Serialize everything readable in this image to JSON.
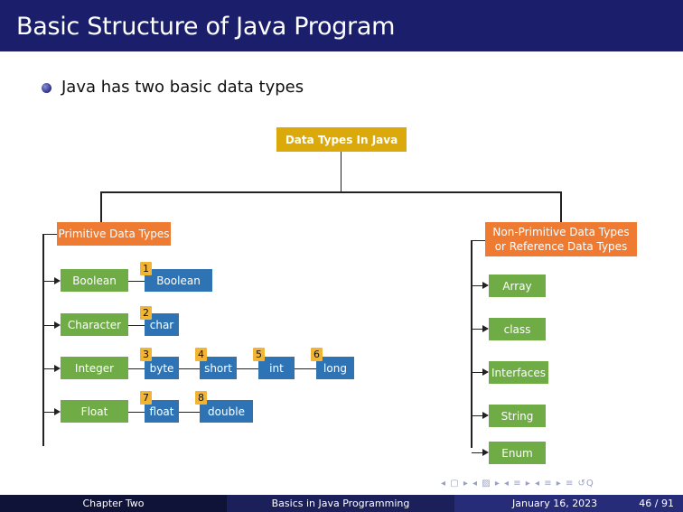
{
  "slide": {
    "title": "Basic Structure of Java Program",
    "bullet": "Java has two basic data types"
  },
  "diagram": {
    "root": "Data Types In Java",
    "primitive": {
      "header": "Primitive Data Types",
      "categories": [
        "Boolean",
        "Character",
        "Integer",
        "Float"
      ],
      "types": [
        "Boolean",
        "char",
        "byte",
        "short",
        "int",
        "long",
        "float",
        "double"
      ],
      "numbers": [
        "1",
        "2",
        "3",
        "4",
        "5",
        "6",
        "7",
        "8"
      ]
    },
    "non_primitive": {
      "header_line1": "Non-Primitive Data Types",
      "header_line2": "or Reference Data Types",
      "items": [
        "Array",
        "class",
        "Interfaces",
        "String",
        "Enum"
      ]
    },
    "colors": {
      "root": "#dca90a",
      "header": "#ef7b32",
      "category": "#6fac46",
      "type": "#2e74b5",
      "number": "#f2b435"
    }
  },
  "footer": {
    "section": "Chapter Two",
    "course": "Basics in Java Programming",
    "date": "January 16, 2023",
    "page": "46 / 91"
  },
  "navigation": {
    "controls": "◂ ▢ ▸ ◂ ▨ ▸ ◂ ≡ ▸ ◂ ≡ ▸ ≡ ↺Q"
  }
}
